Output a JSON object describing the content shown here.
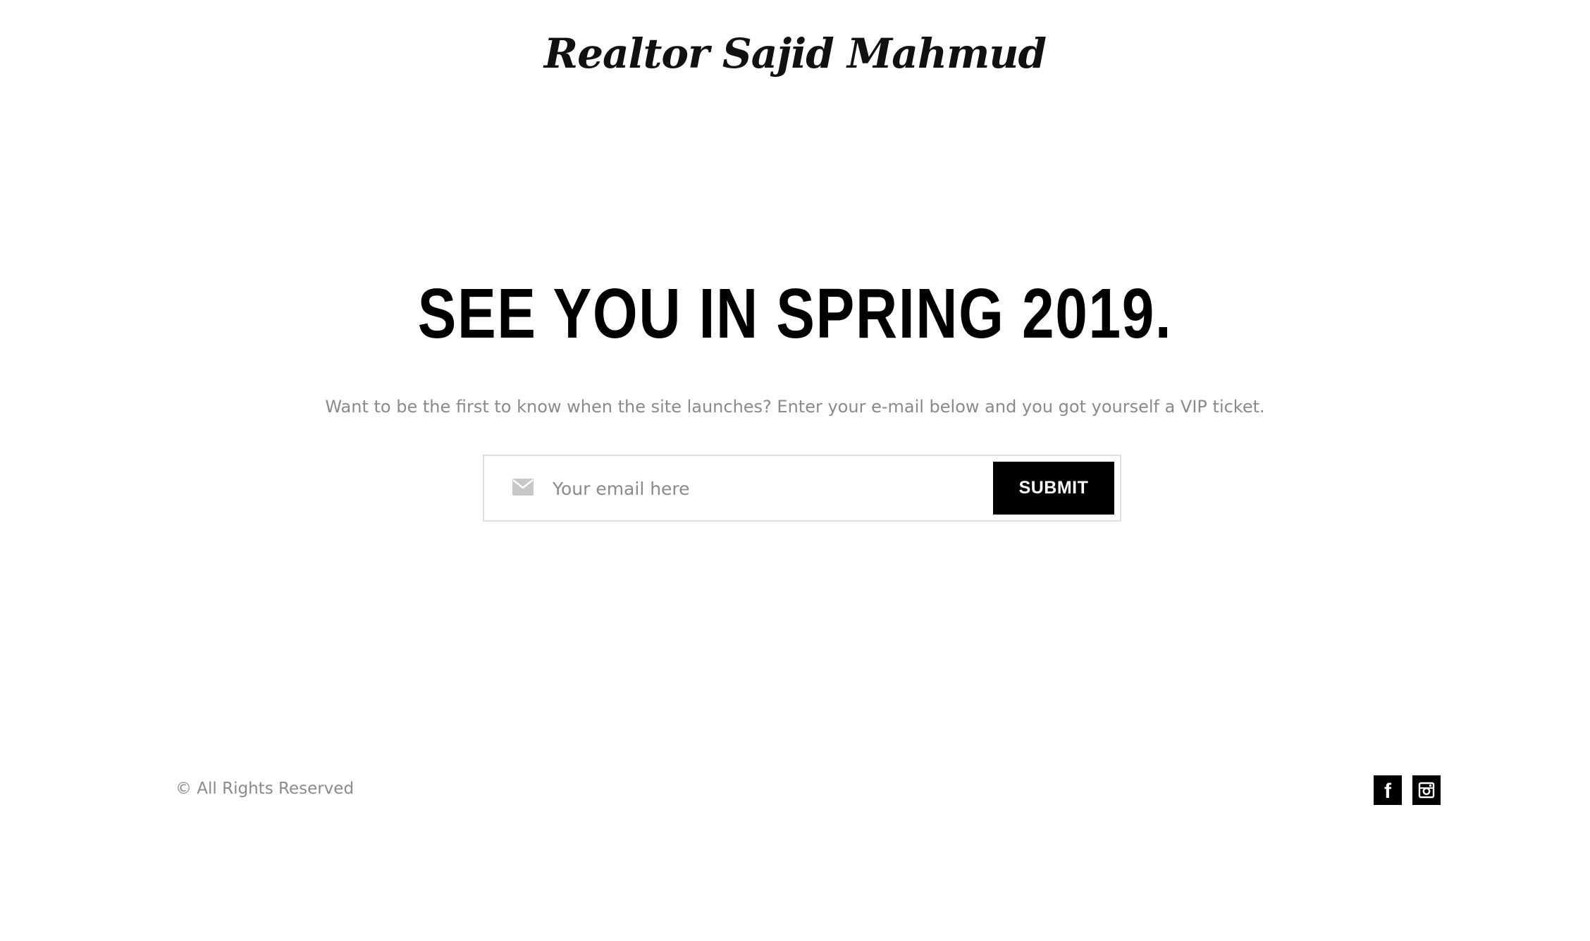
{
  "header": {
    "logo_text": "Realtor Sajid Mahmud"
  },
  "hero": {
    "headline": "SEE YOU IN SPRING 2019.",
    "subtext": "Want to be the first to know when the site launches? Enter your e-mail below and you got yourself a VIP ticket."
  },
  "signup": {
    "icon": "envelope-icon",
    "email_placeholder": "Your email here",
    "email_value": "",
    "submit_label": "SUBMIT"
  },
  "footer": {
    "copyright": "© All Rights Reserved",
    "social": [
      {
        "icon": "facebook-icon"
      },
      {
        "icon": "instagram-icon"
      }
    ]
  },
  "colors": {
    "background": "#ffffff",
    "text_primary": "#000000",
    "text_muted": "#8a8a8a",
    "button_bg": "#000000",
    "border": "#e0e0e0"
  }
}
